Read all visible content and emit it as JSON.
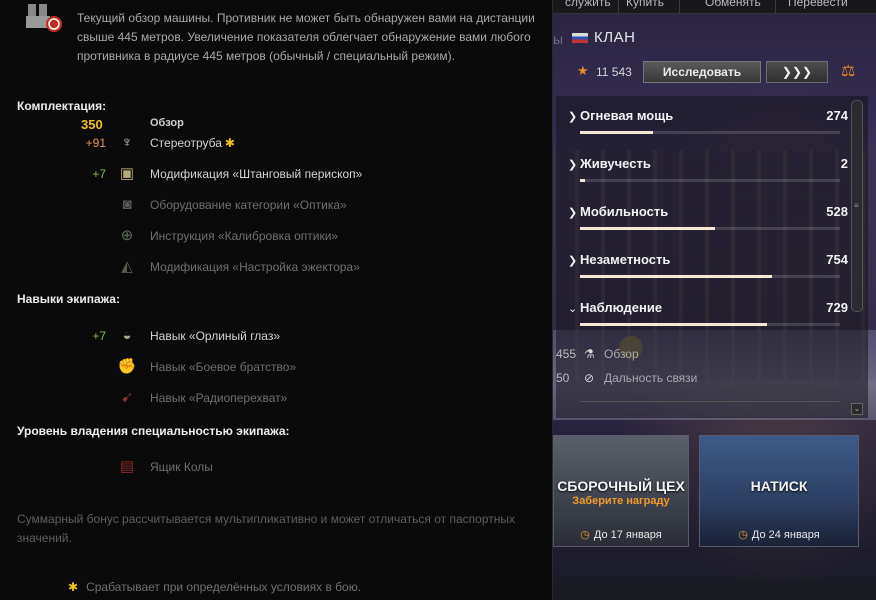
{
  "top_nav": {
    "items": [
      "служить",
      "Купить",
      "Обменять",
      "Перевести"
    ]
  },
  "clan": {
    "ghost_text": "ы",
    "flag_label": "FRANCE",
    "name": "КЛАН"
  },
  "actions": {
    "xp": "11 543",
    "research_label": "Исследовать",
    "compare_glyph": "❯❯❯"
  },
  "stats": [
    {
      "label": "Огневая мощь",
      "value": "274",
      "fill_pct": 28
    },
    {
      "label": "Живучесть",
      "value": "2",
      "fill_pct": 2
    },
    {
      "label": "Мобильность",
      "value": "528",
      "fill_pct": 52
    },
    {
      "label": "Незаметность",
      "value": "754",
      "fill_pct": 74
    },
    {
      "label": "Наблюдение",
      "value": "729",
      "fill_pct": 72,
      "expanded": true
    }
  ],
  "sub_stats": [
    {
      "value": "455",
      "label": "Обзор"
    },
    {
      "value": "50",
      "label": "Дальность связи"
    }
  ],
  "events": [
    {
      "title": "СБОРОЧНЫЙ ЦЕХ",
      "subtitle": "Заберите награду",
      "date": "До 17 января"
    },
    {
      "title": "НАТИСК",
      "subtitle": "",
      "date": "До 24 января"
    }
  ],
  "tooltip": {
    "description": "Текущий обзор машины. Противник не может быть обнаружен вами на дистанции свыше 445 метров. Увеличение показателя облегчает обнаружение вами любого противника в радиусе 445 метров (обычный / специальный режим).",
    "equipment_header": "Комплектация:",
    "base_value": "350",
    "base_label": "Обзор",
    "equipment": [
      {
        "bonus": "+91",
        "name": "Стереотруба",
        "conditional": true,
        "active": true,
        "bonus_color": "orange",
        "icon": "periscope-icon"
      },
      {
        "bonus": "+7",
        "name": "Модификация «Штанговый перископ»",
        "active": true,
        "bonus_color": "green",
        "icon": "rod-periscope-icon"
      },
      {
        "bonus": "",
        "name": "Оборудование категории «Оптика»",
        "active": false,
        "icon": "optics-icon"
      },
      {
        "bonus": "",
        "name": "Инструкция «Калибровка оптики»",
        "active": false,
        "icon": "calibration-icon"
      },
      {
        "bonus": "",
        "name": "Модификация «Настройка эжектора»",
        "active": false,
        "icon": "ejector-icon"
      }
    ],
    "crew_header": "Навыки экипажа:",
    "crew": [
      {
        "bonus": "+7",
        "name": "Навык «Орлиный глаз»",
        "active": true,
        "bonus_color": "green",
        "icon": "eagle-eye-icon"
      },
      {
        "bonus": "",
        "name": "Навык «Боевое братство»",
        "active": false,
        "icon": "brotherhood-icon"
      },
      {
        "bonus": "",
        "name": "Навык «Радиоперехват»",
        "active": false,
        "icon": "radio-intercept-icon"
      }
    ],
    "mastery_header": "Уровень владения специальностью экипажа:",
    "mastery": [
      {
        "bonus": "",
        "name": "Ящик Колы",
        "active": false,
        "icon": "cola-box-icon"
      }
    ],
    "footnote": "Суммарный бонус рассчитывается мультипликативно и может отличаться от паспортных значений.",
    "condition_note": "Срабатывает при определённых условиях в бою."
  }
}
